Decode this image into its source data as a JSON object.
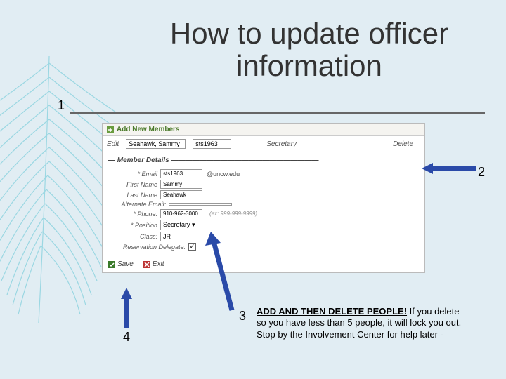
{
  "title": "How to update officer information",
  "nums": {
    "n1": "1",
    "n2": "2",
    "n3": "3",
    "n4": "4"
  },
  "panel": {
    "header": "Add New Members",
    "row": {
      "edit": "Edit",
      "name_value": "Seahawk, Sammy",
      "user_value": "sts1963",
      "role": "Secretary",
      "delete": "Delete"
    },
    "details": {
      "title": "Member Details",
      "email_label": "* Email",
      "email_value": "sts1963",
      "email_domain": "@uncw.edu",
      "first_label": "First Name",
      "first_value": "Sammy",
      "last_label": "Last Name",
      "last_value": "Seahawk",
      "alt_label": "Alternate Email:",
      "phone_label": "* Phone:",
      "phone_value": "910-962-3000",
      "phone_hint": "(ex: 999-999-9999)",
      "pos_label": "* Position",
      "pos_value": "Secretary",
      "class_label": "Class:",
      "class_value": "JR",
      "resdel_label": "Reservation Delegate:",
      "resdel_checked": "✓"
    },
    "buttons": {
      "save": "Save",
      "exit": "Exit"
    }
  },
  "advice": {
    "lead": "ADD AND THEN DELETE PEOPLE!",
    "body": "If you delete so you have less than 5 people, it will lock you out. Stop by the Involvement Center for help later -"
  }
}
